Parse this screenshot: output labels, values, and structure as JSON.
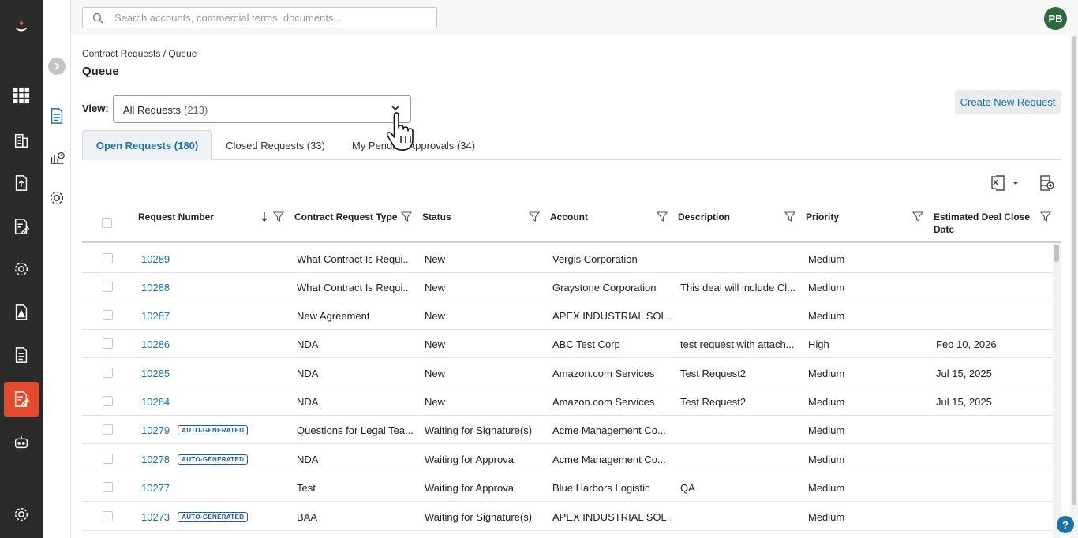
{
  "search": {
    "placeholder": "Search accounts, commercial terms, documents..."
  },
  "user": {
    "initials": "PB"
  },
  "breadcrumb": "Contract Requests / Queue",
  "page_title": "Queue",
  "view": {
    "label": "View:",
    "selected": "All Requests",
    "count": "(213)"
  },
  "create_button": "Create New Request",
  "tabs": [
    {
      "label": "Open Requests (180)"
    },
    {
      "label": "Closed Requests (33)"
    },
    {
      "label": "My Pending Approvals (34)"
    }
  ],
  "table": {
    "columns": {
      "request_number": "Request Number",
      "type": "Contract Request Type",
      "status": "Status",
      "account": "Account",
      "description": "Description",
      "priority": "Priority",
      "close_date": "Estimated Deal Close Date"
    },
    "badge_label": "AUTO-GENERATED",
    "rows": [
      {
        "number": "10289",
        "auto": false,
        "type": "What Contract Is Requi...",
        "status": "New",
        "account": "Vergis Corporation",
        "description": "",
        "priority": "Medium",
        "close_date": ""
      },
      {
        "number": "10288",
        "auto": false,
        "type": "What Contract Is Requi...",
        "status": "New",
        "account": "Graystone Corporation",
        "description": "This deal will include Cl...",
        "priority": "Medium",
        "close_date": ""
      },
      {
        "number": "10287",
        "auto": false,
        "type": "New Agreement",
        "status": "New",
        "account": "APEX INDUSTRIAL SOL...",
        "description": "",
        "priority": "Medium",
        "close_date": ""
      },
      {
        "number": "10286",
        "auto": false,
        "type": "NDA",
        "status": "New",
        "account": "ABC Test Corp",
        "description": "test request with attach...",
        "priority": "High",
        "close_date": "Feb 10, 2026"
      },
      {
        "number": "10285",
        "auto": false,
        "type": "NDA",
        "status": "New",
        "account": "Amazon.com Services",
        "description": "Test Request2",
        "priority": "Medium",
        "close_date": "Jul 15, 2025"
      },
      {
        "number": "10284",
        "auto": false,
        "type": "NDA",
        "status": "New",
        "account": "Amazon.com Services",
        "description": "Test Request2",
        "priority": "Medium",
        "close_date": "Jul 15, 2025"
      },
      {
        "number": "10279",
        "auto": true,
        "type": "Questions for Legal Tea...",
        "status": "Waiting for Signature(s)",
        "account": "Acme Management Co...",
        "description": "",
        "priority": "Medium",
        "close_date": ""
      },
      {
        "number": "10278",
        "auto": true,
        "type": "NDA",
        "status": "Waiting for Approval",
        "account": "Acme Management Co...",
        "description": "",
        "priority": "Medium",
        "close_date": ""
      },
      {
        "number": "10277",
        "auto": false,
        "type": "Test",
        "status": "Waiting for Approval",
        "account": "Blue Harbors Logistic",
        "description": "QA",
        "priority": "Medium",
        "close_date": ""
      },
      {
        "number": "10273",
        "auto": true,
        "type": "BAA",
        "status": "Waiting for Signature(s)",
        "account": "APEX INDUSTRIAL SOL...",
        "description": "",
        "priority": "Medium",
        "close_date": ""
      }
    ]
  },
  "help_label": "?",
  "colors": {
    "accent": "#1a73a8",
    "active_nav": "#e64a2e",
    "rail": "#2b2b2b",
    "avatar": "#2e6b3c"
  },
  "icons": [
    "logo-icon",
    "grid-icon",
    "building-icon",
    "upload-doc-icon",
    "edit-doc-icon",
    "gear-icon",
    "pdf-doc-icon",
    "document-icon",
    "contract-request-icon",
    "bot-icon",
    "settings-icon",
    "expand-icon",
    "queue-doc-icon",
    "report-icon",
    "settings-gear-icon",
    "search-icon",
    "chevron-down-icon",
    "excel-export-icon",
    "column-chooser-icon",
    "sort-down-icon",
    "filter-icon",
    "pointer-cursor-icon"
  ]
}
